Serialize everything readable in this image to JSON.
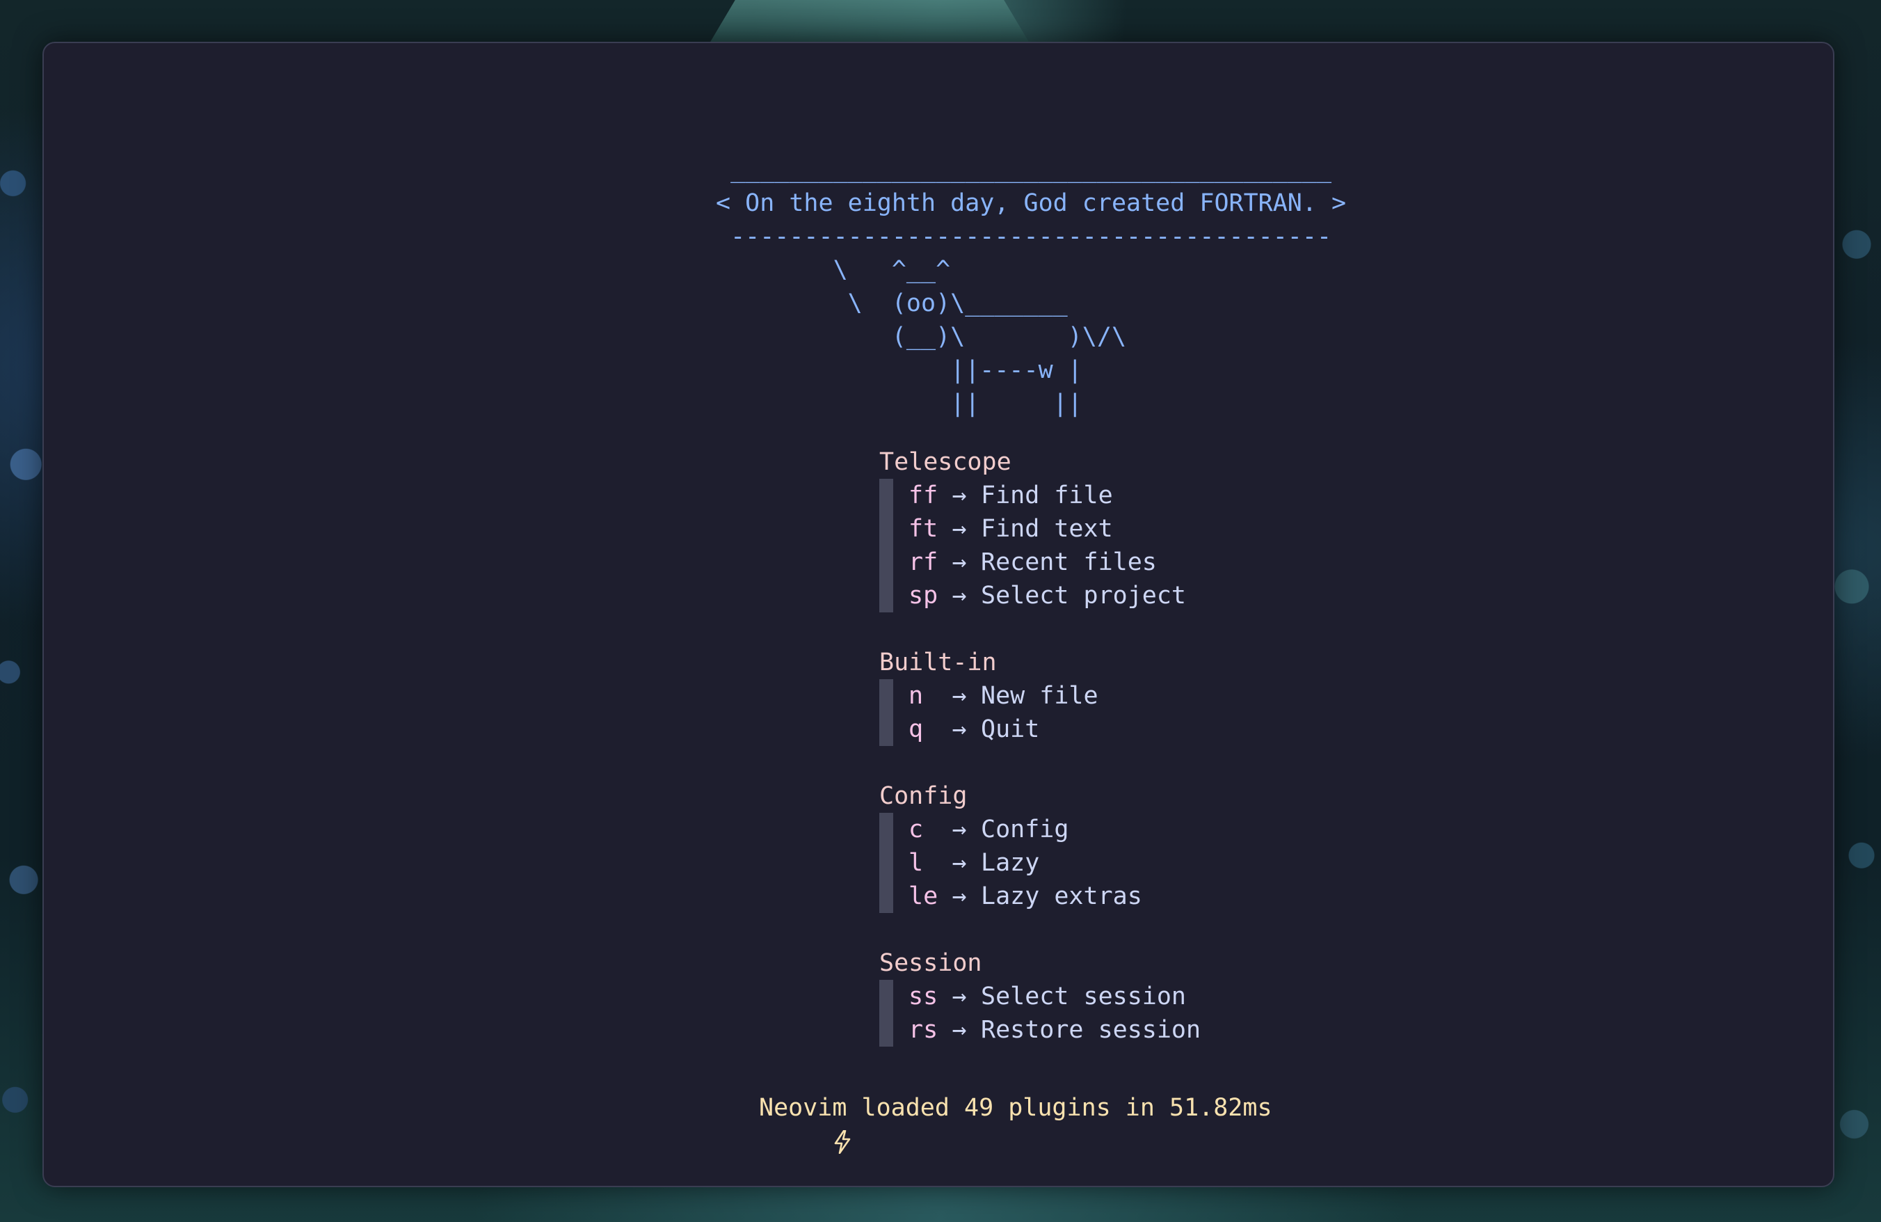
{
  "theme": {
    "background": "#1e1e2e",
    "header_color": "#89b4fa",
    "section_title_color": "#f2cdcd",
    "key_color": "#f5c2e7",
    "text_color": "#cdd6f4",
    "bar_color": "#45475a",
    "footer_color": "#f9e2af"
  },
  "header": {
    "lines": [
      " _________________________________________",
      "< On the eighth day, God created FORTRAN. >",
      " -----------------------------------------",
      "        \\   ^__^",
      "         \\  (oo)\\_______",
      "            (__)\\       )\\/\\",
      "                ||----w |",
      "                ||     ||"
    ]
  },
  "sections": [
    {
      "title": "Telescope",
      "items": [
        {
          "key": "ff",
          "arrow": "→",
          "label": "Find file"
        },
        {
          "key": "ft",
          "arrow": "→",
          "label": "Find text"
        },
        {
          "key": "rf",
          "arrow": "→",
          "label": "Recent files"
        },
        {
          "key": "sp",
          "arrow": "→",
          "label": "Select project"
        }
      ]
    },
    {
      "title": "Built-in",
      "items": [
        {
          "key": "n",
          "arrow": "→",
          "label": "New file"
        },
        {
          "key": "q",
          "arrow": "→",
          "label": "Quit"
        }
      ]
    },
    {
      "title": "Config",
      "items": [
        {
          "key": "c",
          "arrow": "→",
          "label": "Config"
        },
        {
          "key": "l",
          "arrow": "→",
          "label": "Lazy"
        },
        {
          "key": "le",
          "arrow": "→",
          "label": "Lazy extras"
        }
      ]
    },
    {
      "title": "Session",
      "items": [
        {
          "key": "ss",
          "arrow": "→",
          "label": "Select session"
        },
        {
          "key": "rs",
          "arrow": "→",
          "label": "Restore session"
        }
      ]
    }
  ],
  "footer": {
    "icon": "lightning-bolt-icon",
    "text": "Neovim loaded 49 plugins in 51.82ms"
  }
}
